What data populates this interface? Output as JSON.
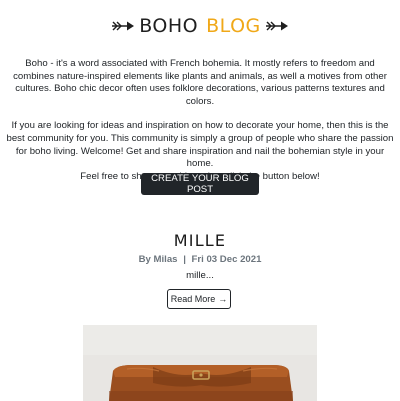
{
  "header": {
    "brand_part1": "BOHO",
    "brand_part2": "BLOG",
    "left_icon": "arrow-right-icon",
    "right_icon": "arrow-right-icon"
  },
  "intro": {
    "paragraph1": "Boho - it's a word associated with French bohemia. It mostly refers to freedom and combines nature-inspired elements like plants and animals, as well a motives from other cultures. Boho chic decor often uses folklore decorations, various patterns textures and colors.",
    "paragraph2_line1": "If you are looking for ideas and inspiration on how to decorate your home, then this is the best community for you. This community is simply a group of people who share the passion for boho living. Welcome! Get and share inspiration and nail the bohemian style in your home.",
    "paragraph2_line2": "Feel free to share your ideas, just click the button below!"
  },
  "cta": {
    "label": "CREATE YOUR BLOG POST"
  },
  "post": {
    "title": "MILLE",
    "author": "By Milas",
    "separator": "|",
    "date": "Fri 03 Dec 2021",
    "excerpt": "mille...",
    "read_more_label": "Read More",
    "read_more_icon": "arrow-right-icon"
  },
  "colors": {
    "brand_accent": "#f0a818",
    "dark": "#212529",
    "muted": "#6c757d"
  }
}
